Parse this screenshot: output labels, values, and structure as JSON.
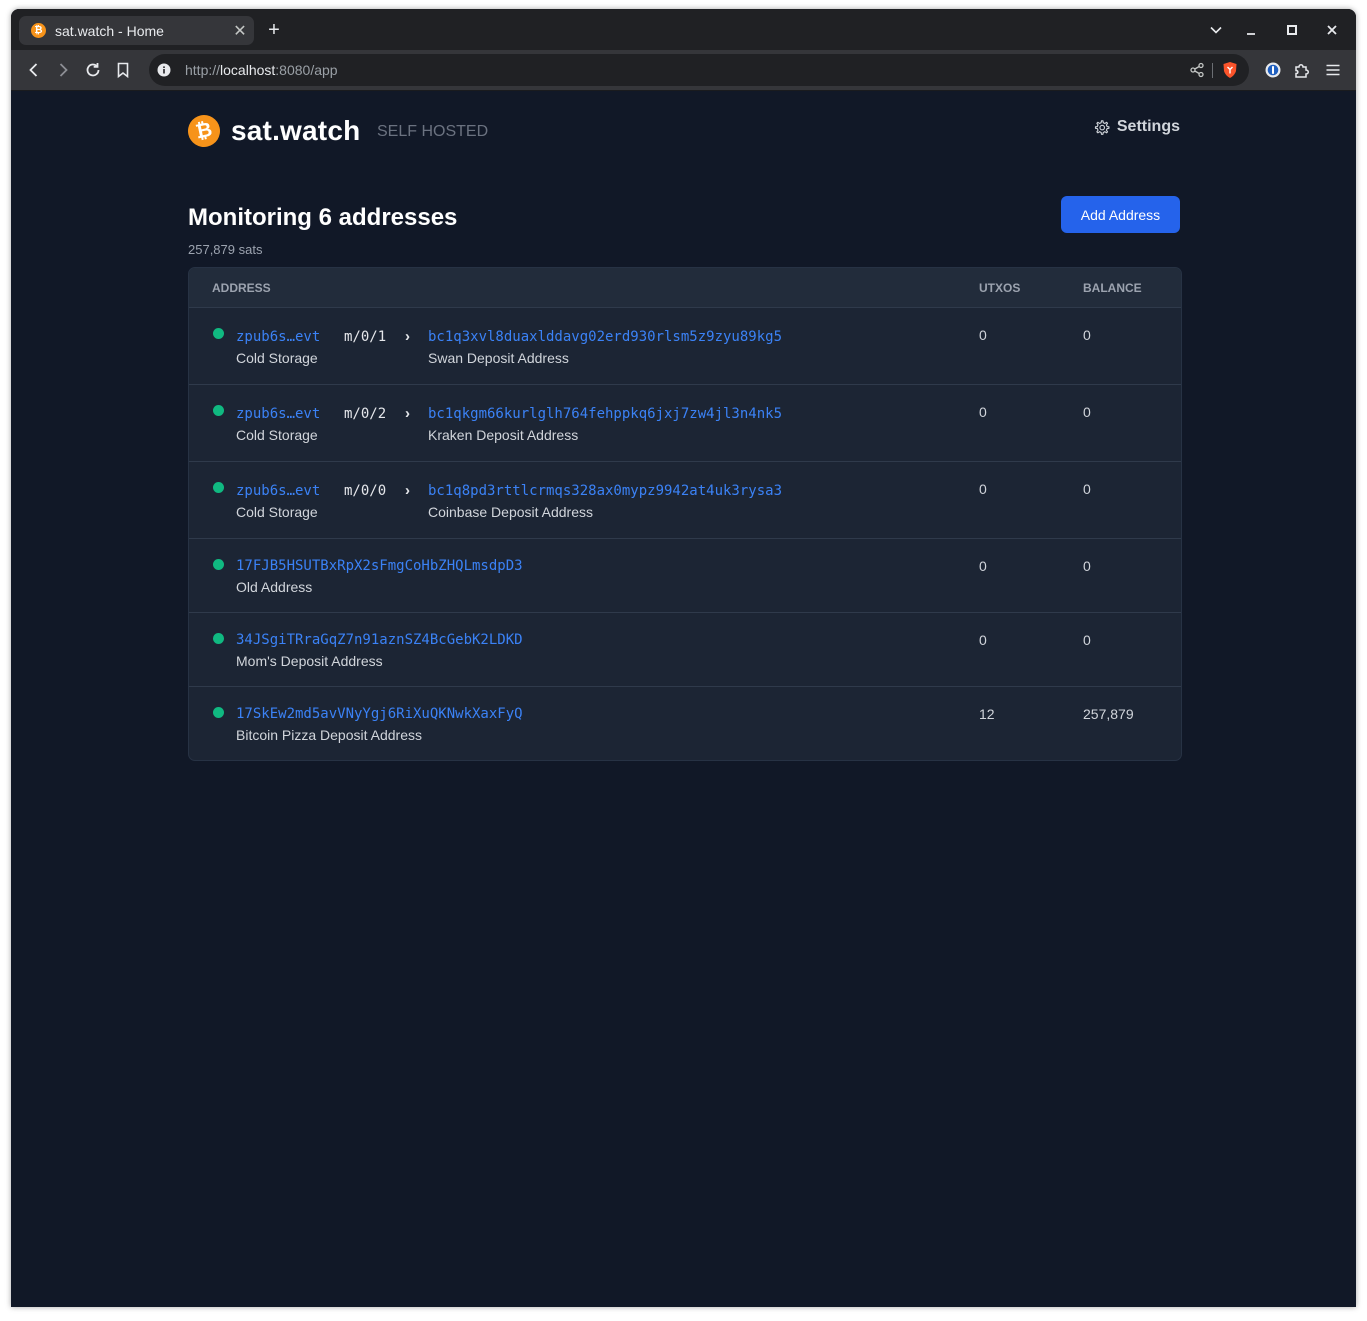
{
  "browser": {
    "tab_title": "sat.watch - Home",
    "new_tab": "+",
    "tab_close": "✕",
    "url_scheme": "http://",
    "url_host": "localhost",
    "url_rest": ":8080/app"
  },
  "app": {
    "logo_glyph": "₿",
    "name": "sat.watch",
    "subtitle": "SELF HOSTED",
    "settings_label": "Settings",
    "brand_color": "#f7931a",
    "accent_color": "#2563eb"
  },
  "summary": {
    "title": "Monitoring 6 addresses",
    "total": "257,879 sats",
    "add_button": "Add Address"
  },
  "table": {
    "columns": [
      "ADDRESS",
      "UTXOS",
      "BALANCE"
    ],
    "derived_rows": [
      {
        "xpub": "zpub6s…evt",
        "xpub_label": "Cold Storage",
        "path": "m/0/1",
        "arrow": "›",
        "address": "bc1q3xvl8duaxlddavg02erd930rlsm5z9zyu89kg5",
        "address_label": "Swan Deposit Address",
        "utxos": "0",
        "balance": "0"
      },
      {
        "xpub": "zpub6s…evt",
        "xpub_label": "Cold Storage",
        "path": "m/0/2",
        "arrow": "›",
        "address": "bc1qkgm66kurlglh764fehppkq6jxj7zw4jl3n4nk5",
        "address_label": "Kraken Deposit Address",
        "utxos": "0",
        "balance": "0"
      },
      {
        "xpub": "zpub6s…evt",
        "xpub_label": "Cold Storage",
        "path": "m/0/0",
        "arrow": "›",
        "address": "bc1q8pd3rttlcrmqs328ax0mypz9942at4uk3rysa3",
        "address_label": "Coinbase Deposit Address",
        "utxos": "0",
        "balance": "0"
      }
    ],
    "plain_rows": [
      {
        "address": "17FJB5HSUTBxRpX2sFmgCoHbZHQLmsdpD3",
        "label": "Old Address",
        "utxos": "0",
        "balance": "0"
      },
      {
        "address": "34JSgiTRraGqZ7n91aznSZ4BcGebK2LDKD",
        "label": "Mom's Deposit Address",
        "utxos": "0",
        "balance": "0"
      },
      {
        "address": "17SkEw2md5avVNyYgj6RiXuQKNwkXaxFyQ",
        "label": "Bitcoin Pizza Deposit Address",
        "utxos": "12",
        "balance": "257,879"
      }
    ]
  }
}
